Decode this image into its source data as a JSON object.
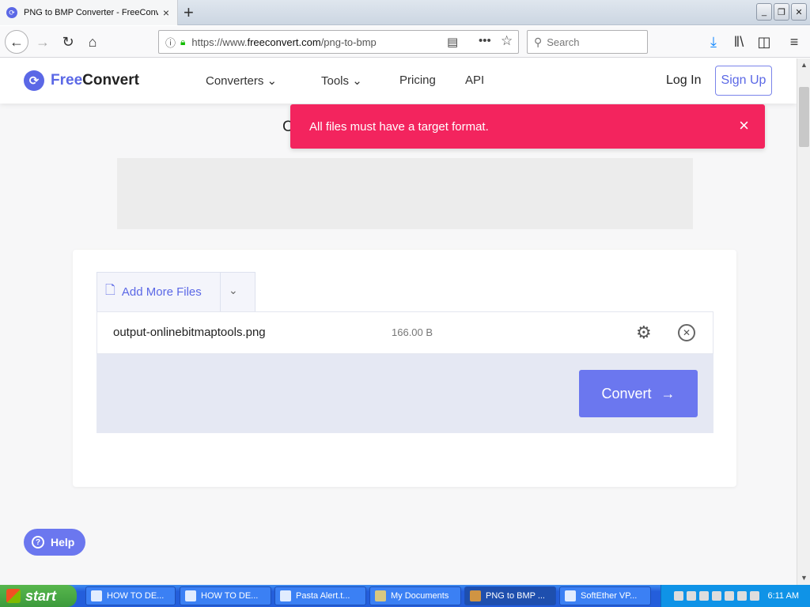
{
  "browser": {
    "tab_title": "PNG to BMP Converter - FreeConvert",
    "tab_close": "×",
    "new_tab": "+",
    "url_prefix": "https://www.",
    "url_domain": "freeconvert.com",
    "url_path": "/png-to-bmp",
    "search_placeholder": "Search",
    "window_controls": [
      "minimize",
      "restore",
      "close"
    ]
  },
  "site": {
    "logo_free": "Free",
    "logo_convert": "Convert",
    "nav": [
      {
        "label": "Converters",
        "has_dropdown": true
      },
      {
        "label": "Tools",
        "has_dropdown": true
      },
      {
        "label": "Pricing",
        "has_dropdown": false
      },
      {
        "label": "API",
        "has_dropdown": false
      }
    ],
    "login": "Log In",
    "signup": "Sign Up",
    "accent_color": "#5b68e6"
  },
  "toast": {
    "message": "All files must have a target format.",
    "close": "×",
    "color": "#f3245e"
  },
  "heading_fragment": "C",
  "uploader": {
    "add_more_label": "Add More Files",
    "file": {
      "name": "output-onlinebitmaptools.png",
      "size": "166.00 B"
    },
    "convert_label": "Convert",
    "convert_arrow": "→"
  },
  "help": {
    "label": "Help"
  },
  "taskbar": {
    "start_label": "start",
    "tasks": [
      {
        "label": "HOW TO DE..."
      },
      {
        "label": "HOW TO DE..."
      },
      {
        "label": "Pasta Alert.t..."
      },
      {
        "label": "My Documents"
      },
      {
        "label": "PNG to BMP ..."
      },
      {
        "label": "SoftEther VP..."
      }
    ],
    "clock": "6:11 AM"
  }
}
